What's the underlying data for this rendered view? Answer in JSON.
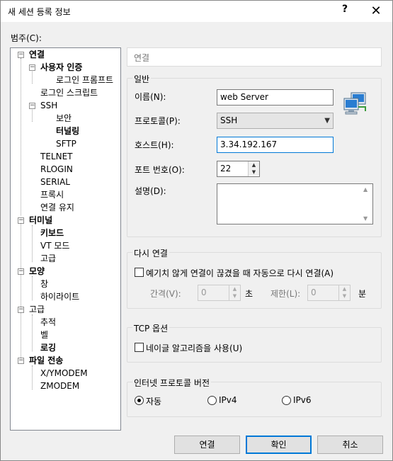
{
  "window": {
    "title": "새 세션 등록 정보",
    "help": "?",
    "close": "✕"
  },
  "category_label": "범주(C):",
  "tree": {
    "connection": "연결",
    "user_auth": "사용자 인증",
    "login_prompt": "로그인 프롬프트",
    "login_script": "로그인 스크립트",
    "ssh": "SSH",
    "security": "보안",
    "tunneling": "터널링",
    "sftp": "SFTP",
    "telnet": "TELNET",
    "rlogin": "RLOGIN",
    "serial": "SERIAL",
    "proxy": "프록시",
    "keepalive": "연결 유지",
    "terminal": "터미널",
    "keyboard": "키보드",
    "vt_mode": "VT 모드",
    "advanced": "고급",
    "appearance": "모양",
    "window": "창",
    "highlight": "하이라이트",
    "advanced2": "고급",
    "trace": "추적",
    "bell": "벨",
    "logging": "로깅",
    "file_transfer": "파일 전송",
    "xymodem": "X/YMODEM",
    "zmodem": "ZMODEM"
  },
  "panel": {
    "header": "연결",
    "general": {
      "title": "일반",
      "name_label": "이름(N):",
      "name_value": "web Server",
      "protocol_label": "프로토콜(P):",
      "protocol_value": "SSH",
      "host_label": "호스트(H):",
      "host_value": "3.34.192.167",
      "port_label": "포트 번호(O):",
      "port_value": "22",
      "desc_label": "설명(D):",
      "desc_value": ""
    },
    "reconnect": {
      "title": "다시 연결",
      "auto_label": "예기치 않게 연결이 끊겼을 때 자동으로 다시 연결(A)",
      "interval_label": "간격(V):",
      "interval_value": "0",
      "interval_unit": "초",
      "limit_label": "제한(L):",
      "limit_value": "0",
      "limit_unit": "분"
    },
    "tcp": {
      "title": "TCP 옵션",
      "nagle_label": "네이글 알고리즘을 사용(U)"
    },
    "ip": {
      "title": "인터넷 프로토콜 버전",
      "auto": "자동",
      "ipv4": "IPv4",
      "ipv6": "IPv6"
    }
  },
  "buttons": {
    "connect": "연결",
    "ok": "확인",
    "cancel": "취소"
  }
}
